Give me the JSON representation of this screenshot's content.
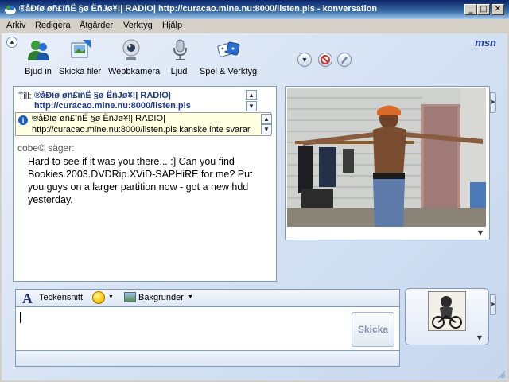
{
  "window": {
    "title": "®åÐíø øñ£ïñË §ø ËñJø¥!| RADIO| http://curacao.mine.nu:8000/listen.pls - konversation",
    "minimize": "_",
    "maximize": "□",
    "close": "✕"
  },
  "menu": [
    "Arkiv",
    "Redigera",
    "Åtgärder",
    "Verktyg",
    "Hjälp"
  ],
  "toolbar": {
    "buttons": [
      {
        "label": "Bjud in",
        "icon": "invite-icon"
      },
      {
        "label": "Skicka filer",
        "icon": "send-files-icon"
      },
      {
        "label": "Webbkamera",
        "icon": "webcam-icon"
      },
      {
        "label": "Ljud",
        "icon": "microphone-icon"
      },
      {
        "label": "Spel & Verktyg",
        "icon": "games-icon"
      }
    ],
    "msn_logo": "msn"
  },
  "conversation": {
    "to_label": "Till:",
    "to_text": "®åÐíø øñ£ïñË §ø ËñJø¥!| RADIO| http://curacao.mine.nu:8000/listen.pls",
    "info_line1": "®åÐíø øñ£ïñË §ø ËñJø¥!| RADIO|",
    "info_line2": "http://curacao.mine.nu:8000/listen.pls kanske inte svarar",
    "sender": "cobe© säger:",
    "message": "Hard to see if it was you there... :] Can you find Bookies.2003.DVDRip.XViD-SAPHiRE for me? Put you guys on a larger partition now - got a new hdd yesterday."
  },
  "compose": {
    "font_label": "Teckensnitt",
    "backgrounds_label": "Bakgrunder",
    "input_value": "",
    "send_label": "Skicka"
  }
}
